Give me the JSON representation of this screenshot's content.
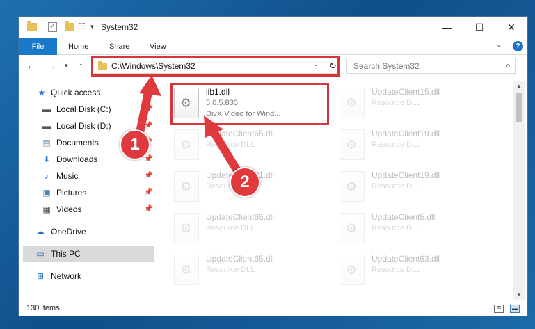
{
  "window": {
    "title": "System32"
  },
  "window_controls": {
    "minimize": "—",
    "maximize": "☐",
    "close": "✕"
  },
  "ribbon": {
    "tabs": [
      "File",
      "Home",
      "Share",
      "View"
    ],
    "help": "?"
  },
  "address": {
    "path": "C:\\Windows\\System32"
  },
  "search": {
    "placeholder": "Search System32"
  },
  "sidebar": {
    "items": [
      {
        "label": "Quick access",
        "icon": "star-icon",
        "pinned": false
      },
      {
        "label": "Local Disk (C:)",
        "icon": "drive-icon",
        "pinned": true
      },
      {
        "label": "Local Disk (D:)",
        "icon": "drive-icon",
        "pinned": true
      },
      {
        "label": "Documents",
        "icon": "document-icon",
        "pinned": true
      },
      {
        "label": "Downloads",
        "icon": "download-icon",
        "pinned": true
      },
      {
        "label": "Music",
        "icon": "music-icon",
        "pinned": true
      },
      {
        "label": "Pictures",
        "icon": "picture-icon",
        "pinned": true
      },
      {
        "label": "Videos",
        "icon": "video-icon",
        "pinned": true
      },
      {
        "label": "OneDrive",
        "icon": "cloud-icon",
        "pinned": false
      },
      {
        "label": "This PC",
        "icon": "computer-icon",
        "pinned": false,
        "selected": true
      },
      {
        "label": "Network",
        "icon": "network-icon",
        "pinned": false
      }
    ]
  },
  "files": [
    {
      "name": "lib1.dll",
      "line1": "5.0.5.830",
      "line2": "DivX Video for Wind...",
      "highlighted": true
    },
    {
      "name": "UpdateClient15.dll",
      "line1": "Resource DLL",
      "faded": true
    },
    {
      "name": "UpdateClient65.dll",
      "line1": "Resource DLL",
      "faded": true
    },
    {
      "name": "UpdateClient19.dll",
      "line1": "Resource DLL",
      "faded": true
    },
    {
      "name": "UpdateClient21.dll",
      "line1": "Resource DLL",
      "faded": true
    },
    {
      "name": "UpdateClient19.dll",
      "line1": "Resource DLL",
      "faded": true
    },
    {
      "name": "UpdateClient65.dll",
      "line1": "Resource DLL",
      "faded": true
    },
    {
      "name": "UpdateClient5.dll",
      "line1": "Resource DLL",
      "faded": true
    },
    {
      "name": "UpdateClient65.dll",
      "line1": "Resource DLL",
      "faded": true
    },
    {
      "name": "UpdateClient63.dll",
      "line1": "Resource DLL",
      "faded": true
    }
  ],
  "status": {
    "item_count": "130 items"
  },
  "annotations": {
    "step1": "1",
    "step2": "2",
    "color": "#d9363b"
  }
}
